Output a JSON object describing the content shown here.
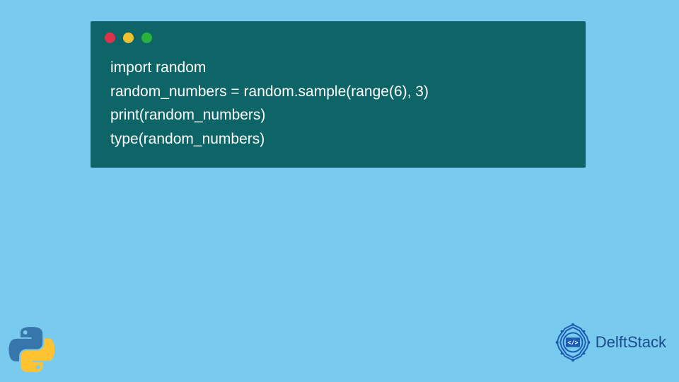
{
  "code": {
    "lines": [
      "import random",
      "random_numbers = random.sample(range(6), 3)",
      "print(random_numbers)",
      "type(random_numbers)"
    ]
  },
  "branding": {
    "name": "DelftStack"
  },
  "window": {
    "dots": [
      "red",
      "yellow",
      "green"
    ]
  }
}
